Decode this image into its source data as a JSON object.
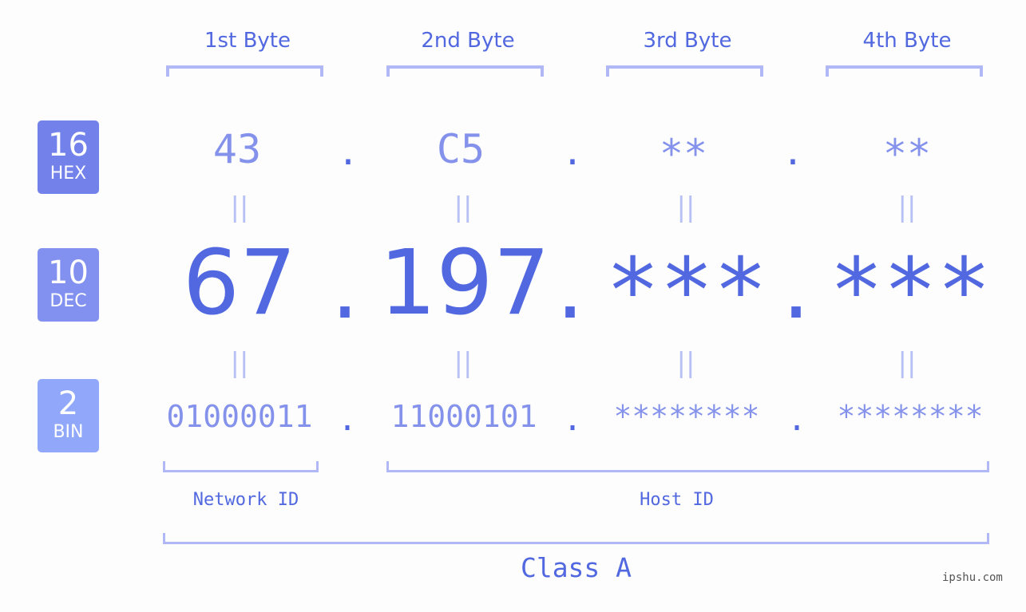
{
  "badges": {
    "hex": {
      "num": "16",
      "label": "HEX",
      "color": "#7382ea"
    },
    "dec": {
      "num": "10",
      "label": "DEC",
      "color": "#8291ef"
    },
    "bin": {
      "num": "2",
      "label": "BIN",
      "color": "#91a8fa"
    }
  },
  "headers": [
    "1st Byte",
    "2nd Byte",
    "3rd Byte",
    "4th Byte"
  ],
  "hex": [
    "43",
    "C5",
    "**",
    "**"
  ],
  "dec": [
    "67",
    "197",
    "***",
    "***"
  ],
  "bin": [
    "01000011",
    "11000101",
    "********",
    "********"
  ],
  "separator": ".",
  "equals": "=",
  "labels": {
    "network": "Network ID",
    "host": "Host ID",
    "class": "Class A"
  },
  "watermark": "ipshu.com",
  "colors": {
    "accent": "#5268e0",
    "light": "#8592ec",
    "bracket": "#b0b9f5",
    "background": "#fcfdfc"
  }
}
